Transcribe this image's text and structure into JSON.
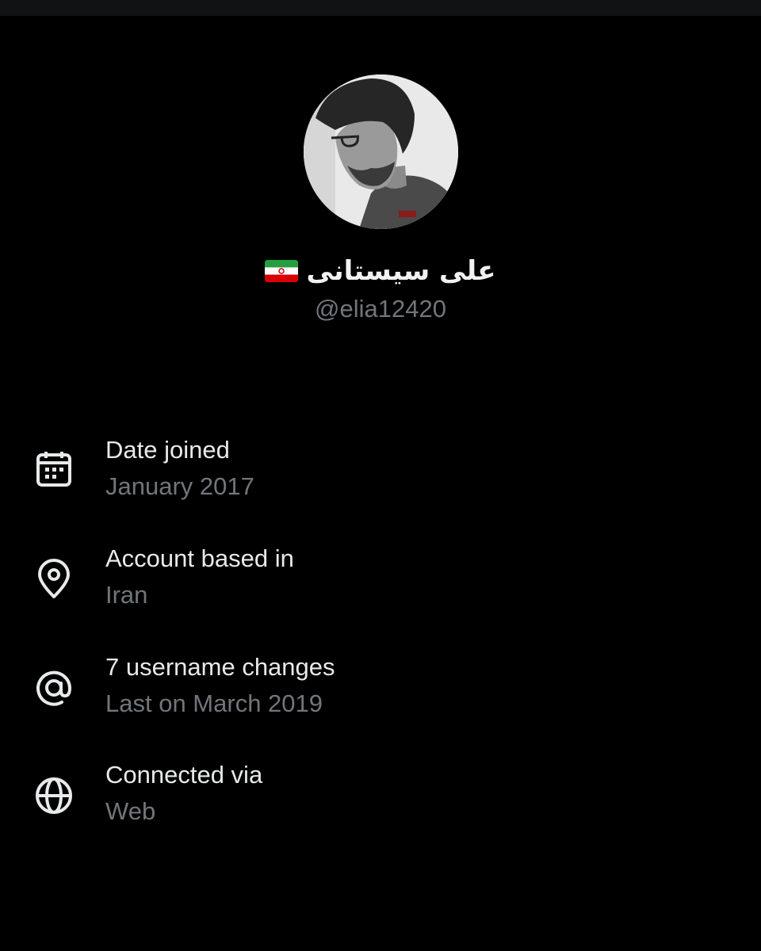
{
  "profile": {
    "display_name": "علی سیستانی",
    "flag_icon": "iran-flag-icon",
    "handle": "@elia12420",
    "avatar": "avatar-photo"
  },
  "info": [
    {
      "icon": "calendar-icon",
      "label": "Date joined",
      "value": "January 2017"
    },
    {
      "icon": "location-pin-icon",
      "label": "Account based in",
      "value": "Iran"
    },
    {
      "icon": "at-sign-icon",
      "label": "7 username changes",
      "value": "Last on March 2019"
    },
    {
      "icon": "globe-icon",
      "label": "Connected via",
      "value": "Web"
    }
  ],
  "colors": {
    "background": "#000000",
    "primary_text": "#e7e9ea",
    "secondary_text": "#71767b"
  }
}
